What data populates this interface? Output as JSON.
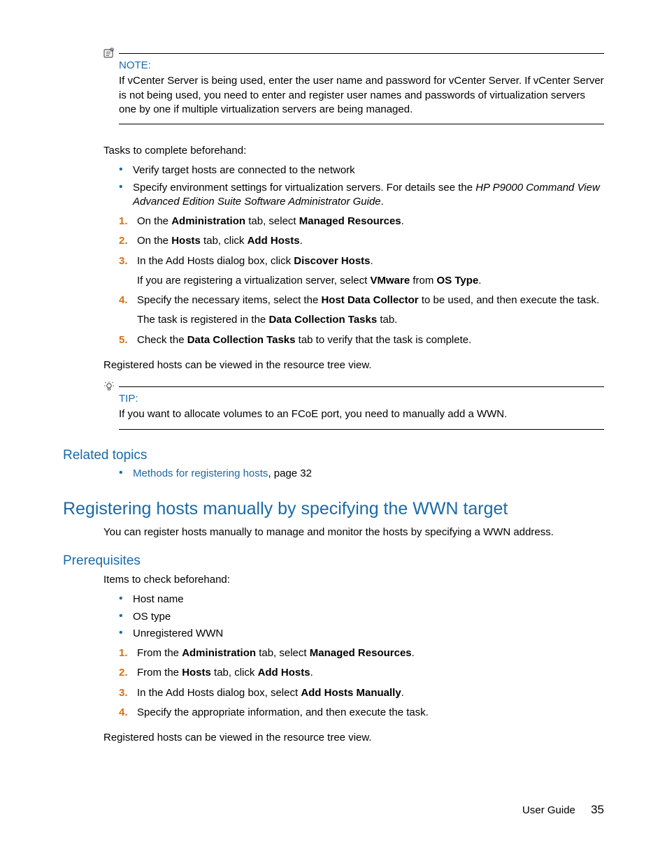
{
  "note": {
    "label": "NOTE:",
    "body": "If vCenter Server is being used, enter the user name and password for vCenter Server. If vCenter Server is not being used, you need to enter and register user names and passwords of virtualization servers one by one if multiple virtualization servers are being managed."
  },
  "tasks_intro": "Tasks to complete beforehand:",
  "tasks_bullets": {
    "b0": "Verify target hosts are connected to the network",
    "b1_pre": "Specify environment settings for virtualization servers. For details see the ",
    "b1_em": "HP P9000 Command View Advanced Edition Suite Software Administrator Guide",
    "b1_post": "."
  },
  "steps1": {
    "s1_a": "On the ",
    "s1_b": "Administration",
    "s1_c": " tab, select ",
    "s1_d": "Managed Resources",
    "s1_e": ".",
    "s2_a": "On the ",
    "s2_b": "Hosts",
    "s2_c": " tab, click ",
    "s2_d": "Add Hosts",
    "s2_e": ".",
    "s3_a": "In the Add Hosts dialog box, click ",
    "s3_b": "Discover Hosts",
    "s3_c": ".",
    "s3_sub_a": "If you are registering a virtualization server, select ",
    "s3_sub_b": "VMware",
    "s3_sub_c": " from ",
    "s3_sub_d": "OS Type",
    "s3_sub_e": ".",
    "s4_a": "Specify the necessary items, select the ",
    "s4_b": "Host Data Collector",
    "s4_c": " to be used, and then execute the task.",
    "s4_sub_a": "The task is registered in the ",
    "s4_sub_b": "Data Collection Tasks",
    "s4_sub_c": " tab.",
    "s5_a": "Check the ",
    "s5_b": "Data Collection Tasks",
    "s5_c": " tab to verify that the task is complete."
  },
  "after_steps1": "Registered hosts can be viewed in the resource tree view.",
  "tip": {
    "label": "TIP:",
    "body": "If you want to allocate volumes to an FCoE port, you need to manually add a WWN."
  },
  "related": {
    "heading": "Related topics",
    "link": "Methods for registering hosts",
    "suffix": ", page 32"
  },
  "section2": {
    "heading": "Registering hosts manually by specifying the WWN target",
    "intro": "You can register hosts manually to manage and monitor the hosts by specifying a WWN address."
  },
  "prereq": {
    "heading": "Prerequisites",
    "intro": "Items to check beforehand:",
    "b0": "Host name",
    "b1": "OS type",
    "b2": "Unregistered WWN"
  },
  "steps2": {
    "s1_a": "From the ",
    "s1_b": "Administration",
    "s1_c": " tab, select ",
    "s1_d": "Managed Resources",
    "s1_e": ".",
    "s2_a": "From the ",
    "s2_b": "Hosts",
    "s2_c": " tab, click ",
    "s2_d": "Add Hosts",
    "s2_e": ".",
    "s3_a": "In the Add Hosts dialog box, select ",
    "s3_b": "Add Hosts Manually",
    "s3_c": ".",
    "s4": "Specify the appropriate information, and then execute the task."
  },
  "after_steps2": "Registered hosts can be viewed in the resource tree view.",
  "footer": {
    "label": "User Guide",
    "page": "35"
  }
}
